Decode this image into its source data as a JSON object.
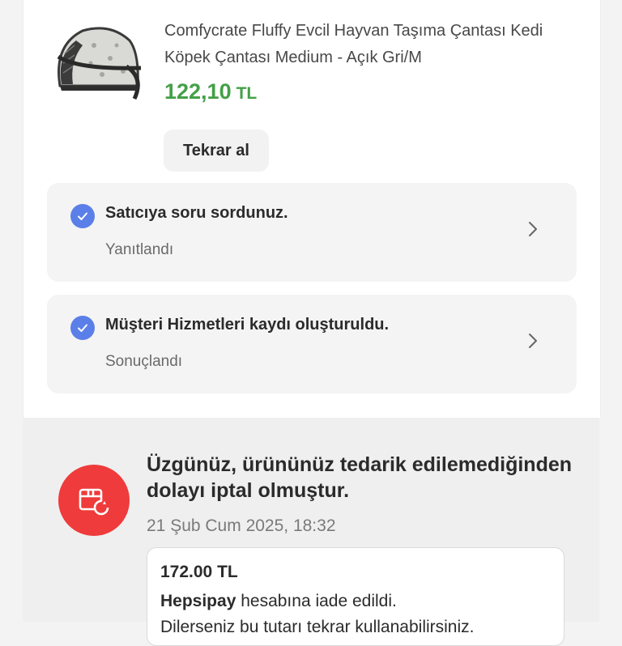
{
  "product": {
    "name": "Comfycrate Fluffy Evcil Hayvan Taşıma Çantası Kedi Köpek Çantası Medium - Açık Gri/M",
    "price": "122,10",
    "currency": "TL",
    "image_icon": "pet-carrier-bag-image"
  },
  "actions": {
    "rebuy_label": "Tekrar al"
  },
  "statuses": [
    {
      "title": "Satıcıya soru sordunuz.",
      "subtitle": "Yanıtlandı",
      "icon": "check-circle-icon"
    },
    {
      "title": "Müşteri Hizmetleri kaydı oluşturuldu.",
      "subtitle": "Sonuçlandı",
      "icon": "check-circle-icon"
    }
  ],
  "cancellation": {
    "title": "Üzgünüz, ürününüz tedarik edilemediğinden dolayı iptal olmuştur.",
    "date": "21 Şub Cum 2025, 18:32",
    "icon": "box-refresh-icon",
    "refund": {
      "amount": "172.00 TL",
      "provider": "Hepsipay",
      "text": " hesabına iade edildi.",
      "more": "Dilerseniz bu tutarı tekrar kullanabilirsiniz."
    }
  },
  "colors": {
    "price_green": "#43a047",
    "check_blue": "#5b7fe8",
    "cancel_red": "#ef3b3b"
  }
}
